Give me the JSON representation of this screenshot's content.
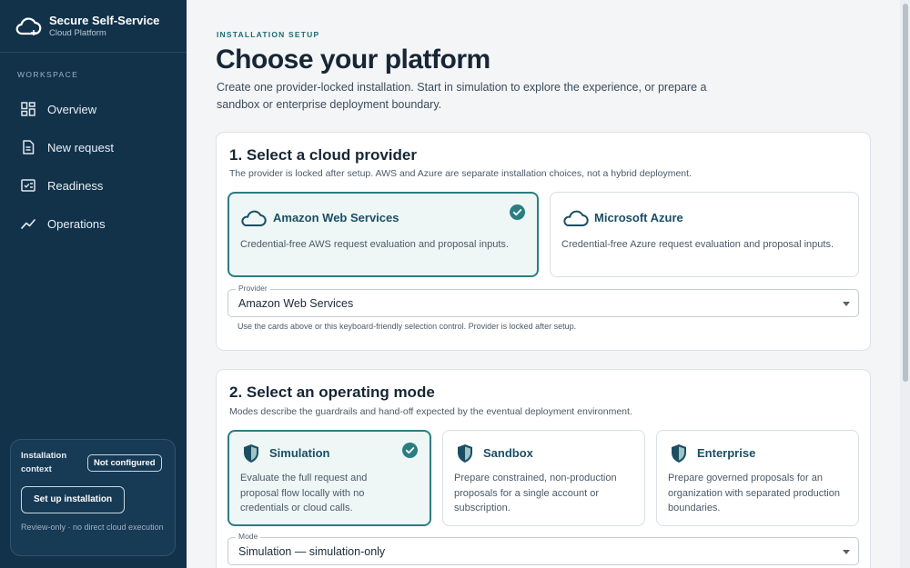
{
  "brand": {
    "name": "Secure Self-Service",
    "subtitle": "Cloud Platform"
  },
  "sidebar": {
    "section_label": "WORKSPACE",
    "items": [
      {
        "label": "Overview",
        "icon": "grid-icon"
      },
      {
        "label": "New request",
        "icon": "document-icon"
      },
      {
        "label": "Readiness",
        "icon": "checklist-icon"
      },
      {
        "label": "Operations",
        "icon": "trend-icon"
      }
    ],
    "context": {
      "label": "Installation context",
      "badge": "Not configured",
      "button": "Set up installation",
      "note": "Review-only · no direct cloud execution"
    }
  },
  "main": {
    "eyebrow": "INSTALLATION SETUP",
    "title": "Choose your platform",
    "description": "Create one provider-locked installation. Start in simulation to explore the experience, or prepare a sandbox or enterprise deployment boundary.",
    "provider": {
      "title": "1. Select a cloud provider",
      "description": "The provider is locked after setup. AWS and Azure are separate installation choices, not a hybrid deployment.",
      "options": [
        {
          "title": "Amazon Web Services",
          "description": "Credential-free AWS request evaluation and proposal inputs.",
          "selected": true
        },
        {
          "title": "Microsoft Azure",
          "description": "Credential-free Azure request evaluation and proposal inputs.",
          "selected": false
        }
      ],
      "select_label": "Provider",
      "select_value": "Amazon Web Services",
      "help": "Use the cards above or this keyboard-friendly selection control. Provider is locked after setup."
    },
    "mode": {
      "title": "2. Select an operating mode",
      "description": "Modes describe the guardrails and hand-off expected by the eventual deployment environment.",
      "options": [
        {
          "title": "Simulation",
          "description": "Evaluate the full request and proposal flow locally with no credentials or cloud calls.",
          "selected": true
        },
        {
          "title": "Sandbox",
          "description": "Prepare constrained, non-production proposals for a single account or subscription.",
          "selected": false
        },
        {
          "title": "Enterprise",
          "description": "Prepare governed proposals for an organization with separated production boundaries.",
          "selected": false
        }
      ],
      "select_label": "Mode",
      "select_value": "Simulation — simulation-only"
    }
  },
  "colors": {
    "sidebar_bg": "#12324a",
    "accent": "#2c7d82",
    "selected_bg": "#eef6f6"
  }
}
